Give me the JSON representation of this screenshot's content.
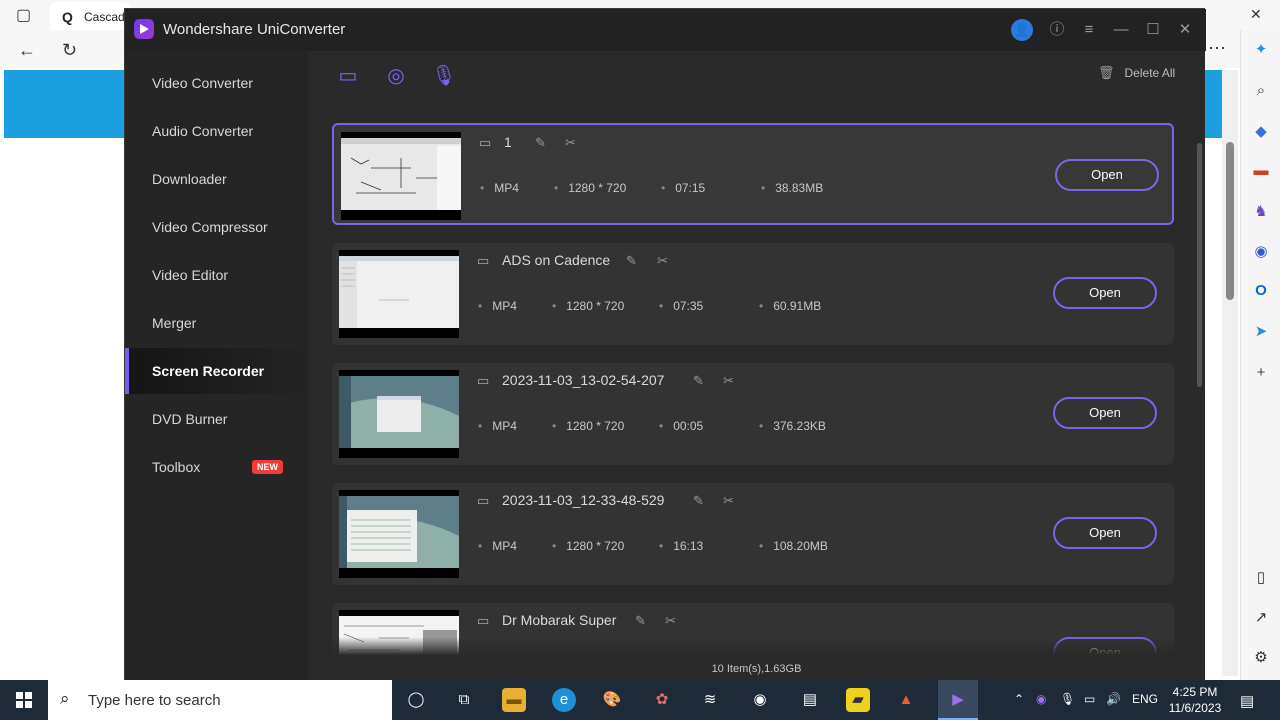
{
  "browser": {
    "tab_title": "Cascade"
  },
  "app": {
    "title": "Wondershare UniConverter",
    "nav": [
      {
        "label": "Video Converter"
      },
      {
        "label": "Audio Converter"
      },
      {
        "label": "Downloader"
      },
      {
        "label": "Video Compressor"
      },
      {
        "label": "Video Editor"
      },
      {
        "label": "Merger"
      },
      {
        "label": "Screen Recorder",
        "active": true
      },
      {
        "label": "DVD Burner"
      },
      {
        "label": "Toolbox",
        "badge": "NEW"
      }
    ],
    "delete_all": "Delete All",
    "open_label": "Open",
    "files": [
      {
        "name": "1",
        "format": "MP4",
        "resolution": "1280 * 720",
        "duration": "07:15",
        "size": "38.83MB"
      },
      {
        "name": "ADS on Cadence",
        "format": "MP4",
        "resolution": "1280 * 720",
        "duration": "07:35",
        "size": "60.91MB"
      },
      {
        "name": "2023-11-03_13-02-54-207",
        "format": "MP4",
        "resolution": "1280 * 720",
        "duration": "00:05",
        "size": "376.23KB"
      },
      {
        "name": "2023-11-03_12-33-48-529",
        "format": "MP4",
        "resolution": "1280 * 720",
        "duration": "16:13",
        "size": "108.20MB"
      },
      {
        "name": "Dr Mobarak Super"
      }
    ],
    "status": "10 Item(s),1.63GB"
  },
  "taskbar": {
    "search_placeholder": "Type here to search",
    "lang": "ENG",
    "time": "4:25 PM",
    "date": "11/6/2023"
  },
  "colors": {
    "accent": "#7b66e8",
    "badge": "#ef3b3b",
    "banner": "#1a9fe0"
  }
}
